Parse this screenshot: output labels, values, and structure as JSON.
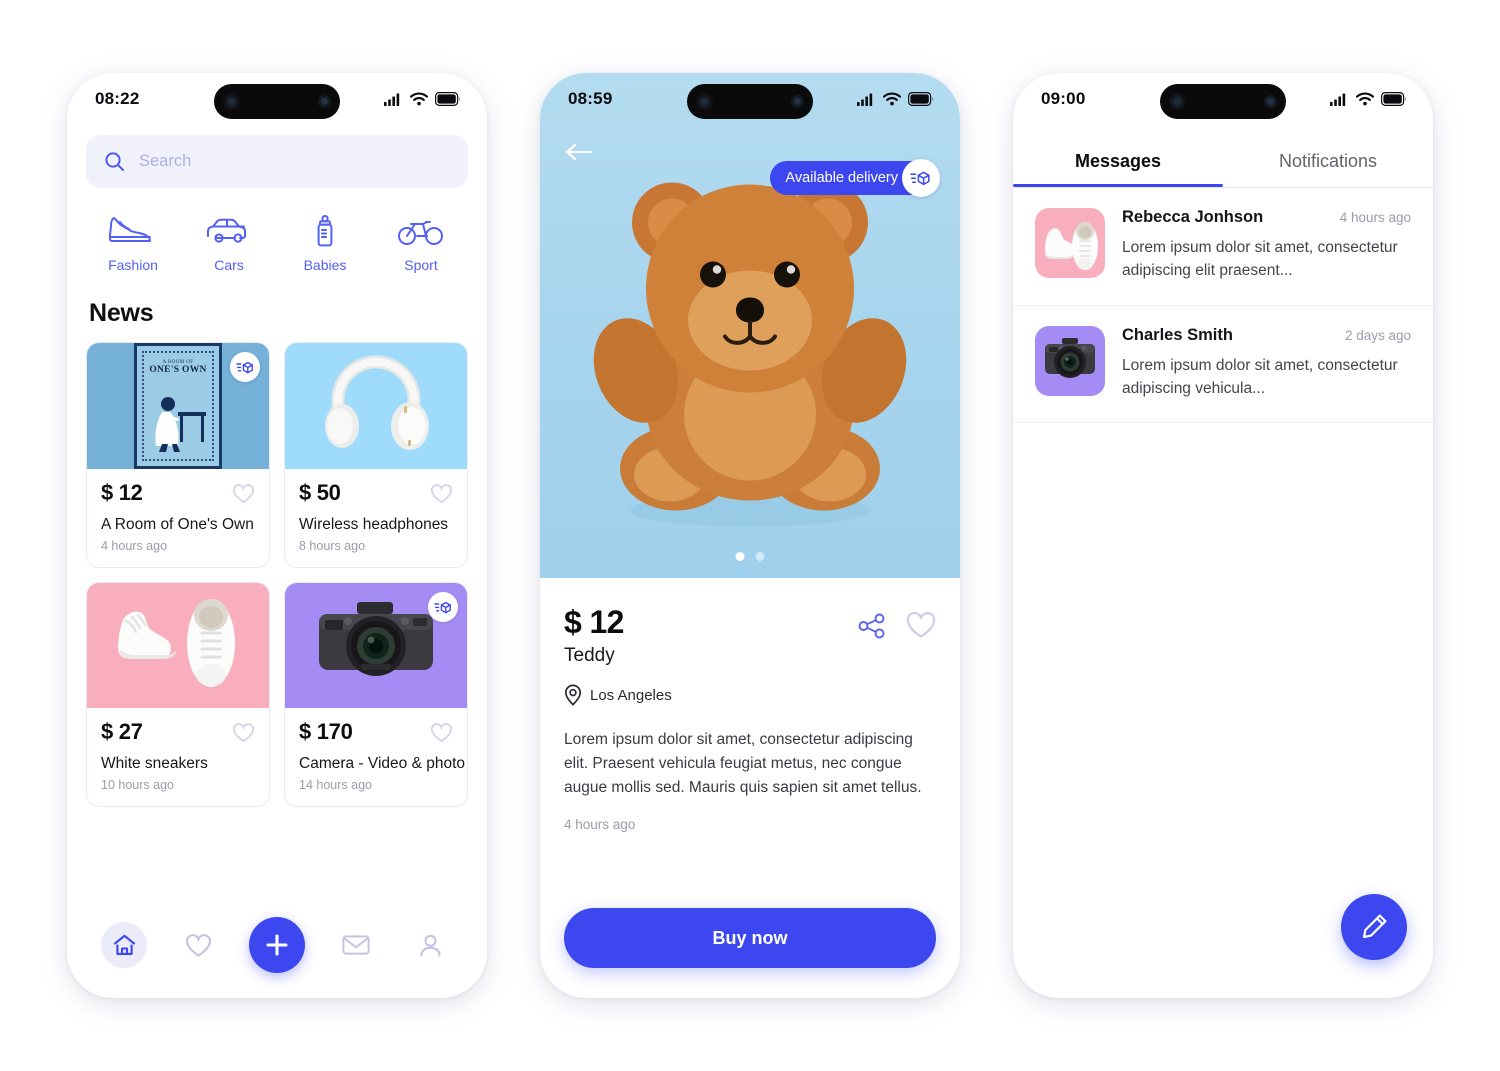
{
  "accent": "#3d47f0",
  "phone_feed": {
    "status": {
      "time": "08:22",
      "icons": [
        "signal-icon",
        "wifi-icon",
        "battery-icon"
      ]
    },
    "search": {
      "placeholder": "Search",
      "value": "",
      "icon": "search-icon"
    },
    "categories": [
      {
        "label": "Fashion",
        "icon": "sneaker-icon"
      },
      {
        "label": "Cars",
        "icon": "car-icon"
      },
      {
        "label": "Babies",
        "icon": "baby-bottle-icon"
      },
      {
        "label": "Sport",
        "icon": "bicycle-icon"
      }
    ],
    "section_title": "News",
    "products": [
      {
        "price": "$ 12",
        "name": "A Room of One's Own",
        "time": "4 hours ago",
        "shipping": true,
        "bg": "#74b0d8",
        "cover_top": "A ROOM OF",
        "cover_main": "ONE'S OWN"
      },
      {
        "price": "$ 50",
        "name": "Wireless headphones",
        "time": "8 hours ago",
        "shipping": false,
        "bg": "#9fdcfb"
      },
      {
        "price": "$ 27",
        "name": "White sneakers",
        "time": "10 hours ago",
        "shipping": false,
        "bg": "#f9aebe"
      },
      {
        "price": "$ 170",
        "name": "Camera - Video & photo",
        "time": "14 hours ago",
        "shipping": true,
        "bg": "#a58bf4"
      }
    ],
    "tabbar": [
      {
        "icon": "home-icon",
        "active": true
      },
      {
        "icon": "heart-icon",
        "active": false
      },
      {
        "icon": "plus-icon",
        "active": false
      },
      {
        "icon": "mail-icon",
        "active": false
      },
      {
        "icon": "person-icon",
        "active": false
      }
    ]
  },
  "phone_product": {
    "status": {
      "time": "08:59"
    },
    "back_icon": "arrow-left-icon",
    "delivery_badge": {
      "label": "Available delivery",
      "icon": "delivery-box-icon"
    },
    "carousel": {
      "count": 2,
      "active_index": 0
    },
    "price": "$ 12",
    "name": "Teddy",
    "location": "Los Angeles",
    "location_icon": "location-pin-icon",
    "share_icon": "share-icon",
    "favorite_icon": "heart-icon",
    "description": "Lorem ipsum dolor sit amet, consectetur adipiscing elit. Praesent vehicula feugiat metus, nec congue augue mollis sed. Mauris quis sapien sit amet tellus.",
    "time": "4 hours ago",
    "buy_label": "Buy now"
  },
  "phone_messages": {
    "status": {
      "time": "09:00"
    },
    "tabs": [
      {
        "label": "Messages",
        "selected": true
      },
      {
        "label": "Notifications",
        "selected": false
      }
    ],
    "messages": [
      {
        "name": "Rebecca Jonhson",
        "time": "4 hours ago",
        "preview": "Lorem ipsum dolor sit amet, consectetur adipiscing elit praesent...",
        "avatar": "sneakers-thumbnail",
        "avatar_bg": "#f9aebe"
      },
      {
        "name": "Charles Smith",
        "time": "2 days ago",
        "preview": "Lorem ipsum dolor sit amet, consectetur adipiscing vehicula...",
        "avatar": "camera-thumbnail",
        "avatar_bg": "#a58bf4"
      }
    ],
    "compose_icon": "pencil-icon"
  }
}
